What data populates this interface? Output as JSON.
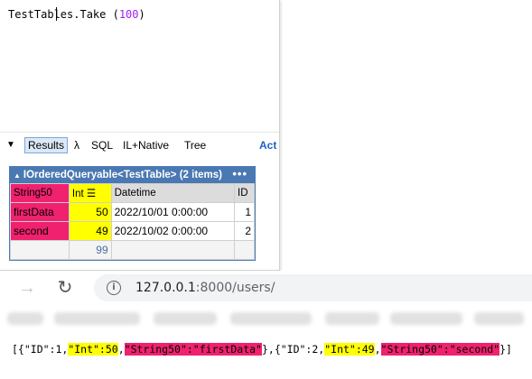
{
  "editor": {
    "code_text": "TestTables.Take (",
    "code_number": "100",
    "code_close": ")"
  },
  "output_tabs": {
    "collapse_glyph": "▼",
    "results": "Results",
    "lambda": "λ",
    "sql": "SQL",
    "native": "IL+Native",
    "tree": "Tree",
    "act": "Act"
  },
  "result_grid": {
    "title": "IOrderedQueryable<TestTable> (2 items)",
    "title_glyph": "▲",
    "more": "•••",
    "columns": [
      "String50",
      "Int ☰",
      "Datetime",
      "ID"
    ],
    "rows": [
      [
        "firstData",
        "50",
        "2022/10/01 0:00:00",
        "1"
      ],
      [
        "second",
        "49",
        "2022/10/02 0:00:00",
        "2"
      ]
    ],
    "sum_row": [
      "",
      "99",
      "",
      ""
    ]
  },
  "browser": {
    "back_glyph": "→",
    "reload_glyph": "↻",
    "info_glyph": "i",
    "url_host": "127.0.0.1",
    "url_rest": ":8000/users/"
  },
  "json_output": {
    "segments": [
      {
        "text": "[{\"ID\":1,",
        "hl": ""
      },
      {
        "text": "\"Int\":50",
        "hl": "yellow"
      },
      {
        "text": ",",
        "hl": ""
      },
      {
        "text": "\"String50\":\"firstData\"",
        "hl": "pink"
      },
      {
        "text": "},{\"ID\":2,",
        "hl": ""
      },
      {
        "text": "\"Int\":49",
        "hl": "yellow"
      },
      {
        "text": ",",
        "hl": ""
      },
      {
        "text": "\"String50\":\"second\"",
        "hl": "pink"
      },
      {
        "text": "}]",
        "hl": ""
      }
    ]
  },
  "colors": {
    "highlight_pink": "#f0216e",
    "highlight_yellow": "#ffff00",
    "grid_header": "#4a78b2",
    "number_literal": "#a020f0"
  }
}
